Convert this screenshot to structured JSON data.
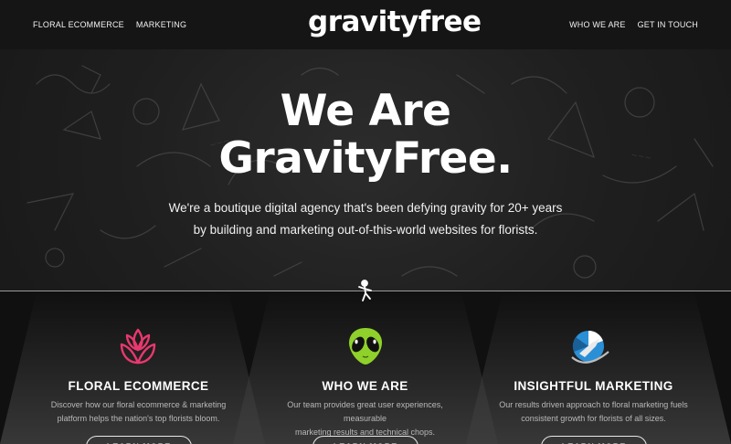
{
  "header": {
    "nav_left": [
      "FLORAL ECOMMERCE",
      "MARKETING"
    ],
    "logo": "gravityfree",
    "nav_right": [
      "WHO WE ARE",
      "GET IN TOUCH"
    ]
  },
  "hero": {
    "title_line1": "We Are",
    "title_line2": "GravityFree.",
    "subtitle_line1": "We're a boutique digital agency that's been defying gravity for 20+ years",
    "subtitle_line2": "by building and marketing out-of-this-world websites for florists."
  },
  "services": [
    {
      "icon": "lotus-flower-icon",
      "title": "FLORAL ECOMMERCE",
      "text_line1": "Discover how our floral ecommerce & marketing",
      "text_line2": "platform helps the nation's top florists bloom.",
      "button": "LEARN MORE"
    },
    {
      "icon": "alien-head-icon",
      "title": "WHO WE ARE",
      "text_line1": "Our team provides great user experiences, measurable",
      "text_line2": "marketing results and technical chops.",
      "button": "LEARN MORE"
    },
    {
      "icon": "rocket-pie-chart-icon",
      "title": "INSIGHTFUL MARKETING",
      "text_line1": "Our results driven approach to floral marketing fuels",
      "text_line2": "consistent growth for florists of all sizes.",
      "button": "LEARN MORE"
    }
  ],
  "colors": {
    "lotus": "#e8386e",
    "alien": "#8fd12a",
    "marketing": "#2b8fd6"
  }
}
